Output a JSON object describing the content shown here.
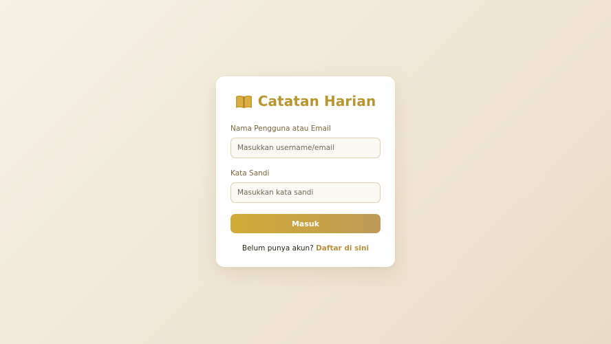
{
  "app": {
    "title": "Catatan Harian",
    "icon": "book-icon"
  },
  "form": {
    "username_label": "Nama Pengguna atau Email",
    "username_placeholder": "Masukkan username/email",
    "username_value": "",
    "password_label": "Kata Sandi",
    "password_placeholder": "Masukkan kata sandi",
    "password_value": "",
    "submit_label": "Masuk"
  },
  "register": {
    "prompt": "Belum punya akun?",
    "link_label": "Daftar di sini"
  },
  "colors": {
    "accent": "#b9952f",
    "button_start": "#d2aa37",
    "button_end": "#bd9a5a",
    "link": "#bb8f3f",
    "label": "#7a6438"
  }
}
